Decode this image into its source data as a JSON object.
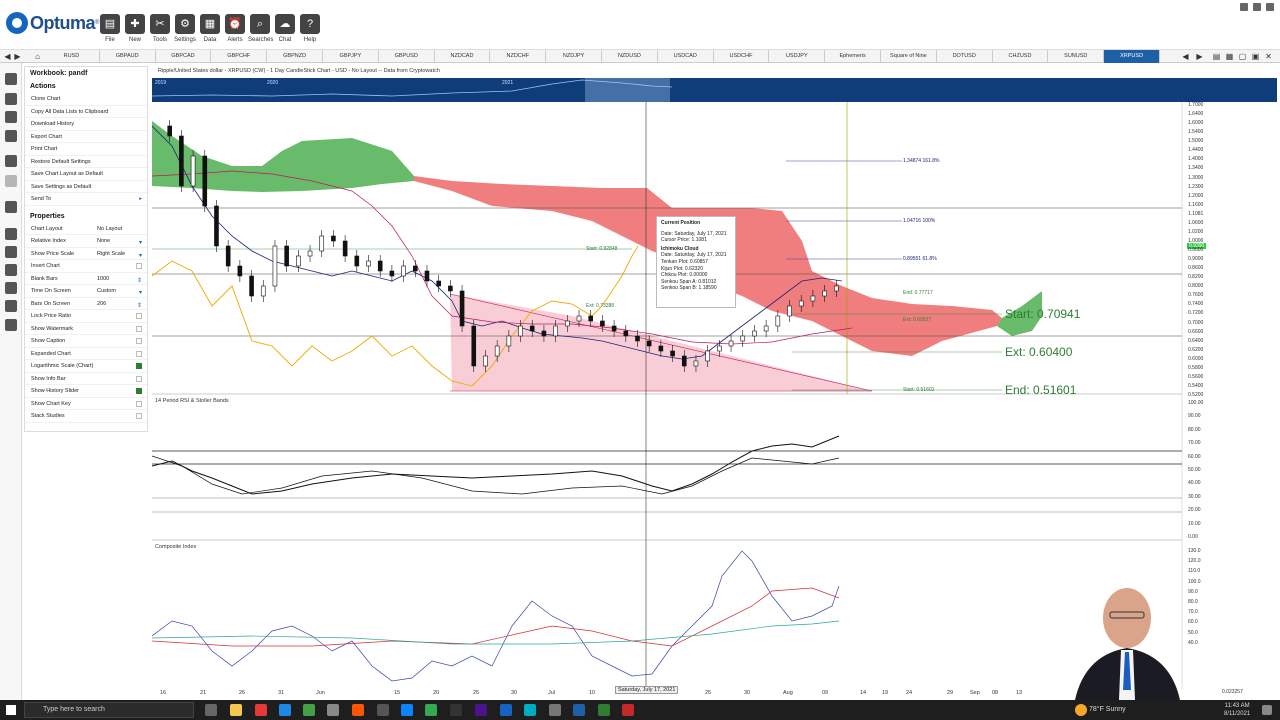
{
  "app": {
    "name": "Optuma"
  },
  "ribbon": {
    "buttons": [
      {
        "label": "File",
        "icon": "folder-icon"
      },
      {
        "label": "New",
        "icon": "new-folder-icon"
      },
      {
        "label": "Tools",
        "icon": "tools-icon"
      },
      {
        "label": "Settings",
        "icon": "gear-icon"
      },
      {
        "label": "Data",
        "icon": "data-icon"
      },
      {
        "label": "Alerts",
        "icon": "alarm-clock-icon"
      },
      {
        "label": "Searches",
        "icon": "magnifier-icon"
      },
      {
        "label": "Chat",
        "icon": "chat-icon"
      },
      {
        "label": "Help",
        "icon": "question-icon"
      }
    ]
  },
  "tabs": [
    "RUSD",
    "GBPAUD",
    "GBPCAD",
    "GBPCHF",
    "GBPNZD",
    "GBPJPY",
    "GBPUSD",
    "NZDCAD",
    "NZDCHF",
    "NZDJPY",
    "NZDUSD",
    "USDCAD",
    "USDCHF",
    "USDJPY",
    "Ephemeris",
    "Square of Nine",
    "DOTUSD",
    "CHZUSD",
    "SUNUSD",
    "XRPUSD"
  ],
  "active_tab": "XRPUSD",
  "workbook": {
    "title": "Workbook: pandf",
    "actions_header": "Actions",
    "actions": [
      "Clone Chart",
      "Copy All Data Lists to Clipboard",
      "Download History",
      "Export Chart",
      "Print Chart",
      "Restore Default Settings",
      "Save Chart Layout as Default",
      "Save Settings as Default",
      "Send To"
    ],
    "properties_header": "Properties",
    "properties": [
      {
        "label": "Chart Layout",
        "value": "No Layout",
        "control": "none"
      },
      {
        "label": "Relative Index",
        "value": "None",
        "control": "dropdown"
      },
      {
        "label": "Show Price Scale",
        "value": "Right Scale",
        "control": "dropdown"
      },
      {
        "label": "Invert Chart",
        "value": "",
        "control": "check",
        "checked": false
      },
      {
        "label": "Blank Bars",
        "value": "1000",
        "control": "spin"
      },
      {
        "label": "Time On Screen",
        "value": "Custom",
        "control": "dropdown"
      },
      {
        "label": "Bars On Screen",
        "value": "206",
        "control": "spin"
      },
      {
        "label": "Lock Price Ratio",
        "value": "",
        "control": "check",
        "checked": false
      },
      {
        "label": "Show Watermark",
        "value": "",
        "control": "check",
        "checked": false
      },
      {
        "label": "Show Caption",
        "value": "",
        "control": "check",
        "checked": false
      },
      {
        "label": "Expanded Chart",
        "value": "",
        "control": "check",
        "checked": false
      },
      {
        "label": "Logarithmic Scale (Chart)",
        "value": "",
        "control": "check",
        "checked": true
      },
      {
        "label": "Show Info Bar",
        "value": "",
        "control": "check",
        "checked": false
      },
      {
        "label": "Show History Slider",
        "value": "",
        "control": "check",
        "checked": true
      },
      {
        "label": "Show Chart Key",
        "value": "",
        "control": "check",
        "checked": false
      },
      {
        "label": "Stack Studies",
        "value": "",
        "control": "check",
        "checked": false
      }
    ]
  },
  "chart": {
    "caption": "Ripple/United States dollar - XRPUSD (CW) - 1 Day CandleStick Chart - USD - No Layout -- Data from Cryptowatch",
    "slider_years": [
      "2019",
      "2020",
      "2021"
    ],
    "rsi_title": "14 Period RSI & Stoller Bands",
    "composite_title": "Composite Index",
    "price_badge": "0.9390",
    "date_badge": "Saturday, July 17, 2021",
    "price_ticks": [
      "1.7000",
      "1.6400",
      "1.6000",
      "1.5400",
      "1.5000",
      "1.4400",
      "1.4000",
      "1.3400",
      "1.3000",
      "1.2300",
      "1.2000",
      "1.1600",
      "1.1081",
      "1.0600",
      "1.0200",
      "1.0000",
      "0.9600",
      "0.9000",
      "0.8600",
      "0.8200",
      "0.8000",
      "0.7600",
      "0.7400",
      "0.7200",
      "0.7000",
      "0.6600",
      "0.6400",
      "0.6200",
      "0.6000",
      "0.5800",
      "0.5600",
      "0.5400",
      "0.5200"
    ],
    "rsi_ticks": [
      "100.00",
      "90.00",
      "80.00",
      "70.00",
      "60.00",
      "50.00",
      "40.00",
      "30.00",
      "20.00",
      "10.00",
      "0.00"
    ],
    "ci_ticks": [
      "130.0",
      "120.0",
      "110.0",
      "100.0",
      "90.0",
      "80.0",
      "70.0",
      "60.0",
      "50.0",
      "40.0"
    ],
    "x_ticks": [
      "16",
      "21",
      "26",
      "31",
      "Jun",
      "15",
      "20",
      "25",
      "30",
      "Jul",
      "10",
      "25",
      "30",
      "Aug",
      "09",
      "14",
      "19",
      "24",
      "29",
      "Sep",
      "08",
      "13"
    ],
    "last_value": "0.023257",
    "tooltip": {
      "header": "Current Position",
      "date": "Date: Saturday, July 17, 2021",
      "cursor": "Cursor Price: 1.1081",
      "section": "Ichimoku Cloud",
      "date2": "Date: Saturday, July 17, 2021",
      "tenkan": "Tenkan Plot: 0.60857",
      "kijun": "Kijun Plot: 0.62320",
      "chikou": "Chikou Plot: 0.00000",
      "span_a": "Senkou Span A: 0.81012",
      "span_b": "Senkou Span B: 1.18590"
    },
    "fib_labels_small": [
      "1.34874   161.8%",
      "1.04716   100%",
      "0.89551   61.8%"
    ],
    "fib_labels_green_small": [
      "Start: 0.92848",
      "Ext: 0.73388",
      "End: 0.77717",
      "Ext: 0.69527",
      "Start: 0.51601"
    ],
    "fib_labels_big": [
      "Start: 0.70941",
      "Ext: 0.60400",
      "End: 0.51601"
    ],
    "colors": {
      "cloud_bear": "#f07070",
      "cloud_bull": "#4caf50",
      "triangle": "#f8c8d2",
      "tenkan": "#1a237e",
      "chikou": "#f0a800",
      "kijun": "#c2185b"
    }
  },
  "taskbar": {
    "search_placeholder": "Type here to search",
    "weather": "78°F  Sunny",
    "time": "11:43 AM",
    "date": "8/11/2021"
  }
}
